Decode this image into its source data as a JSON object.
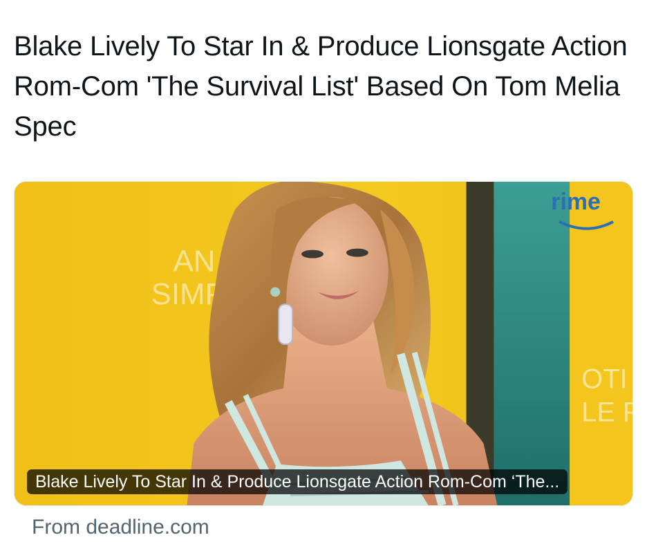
{
  "post": {
    "text": "Blake Lively To Star In & Produce Lionsgate Action Rom-Com 'The Survival List' Based On Tom Melia Spec"
  },
  "link_card": {
    "caption": "Blake Lively To Star In & Produce Lionsgate Action Rom-Com ‘The...",
    "source": "From deadline.com",
    "image_description_colors": {
      "backdrop_yellow": "#f2c419",
      "teal_panel": "#2f8c86",
      "dress": "#cfe7e1"
    },
    "backdrop_text": {
      "left_line_1": "AN",
      "left_line_2": "SIMP",
      "right_logo": "rime",
      "right_line_1": "OTI",
      "right_line_2": "LE F"
    }
  },
  "colors": {
    "text_primary": "#0f1419",
    "text_secondary": "#536471",
    "card_border": "#e6e9ec"
  }
}
